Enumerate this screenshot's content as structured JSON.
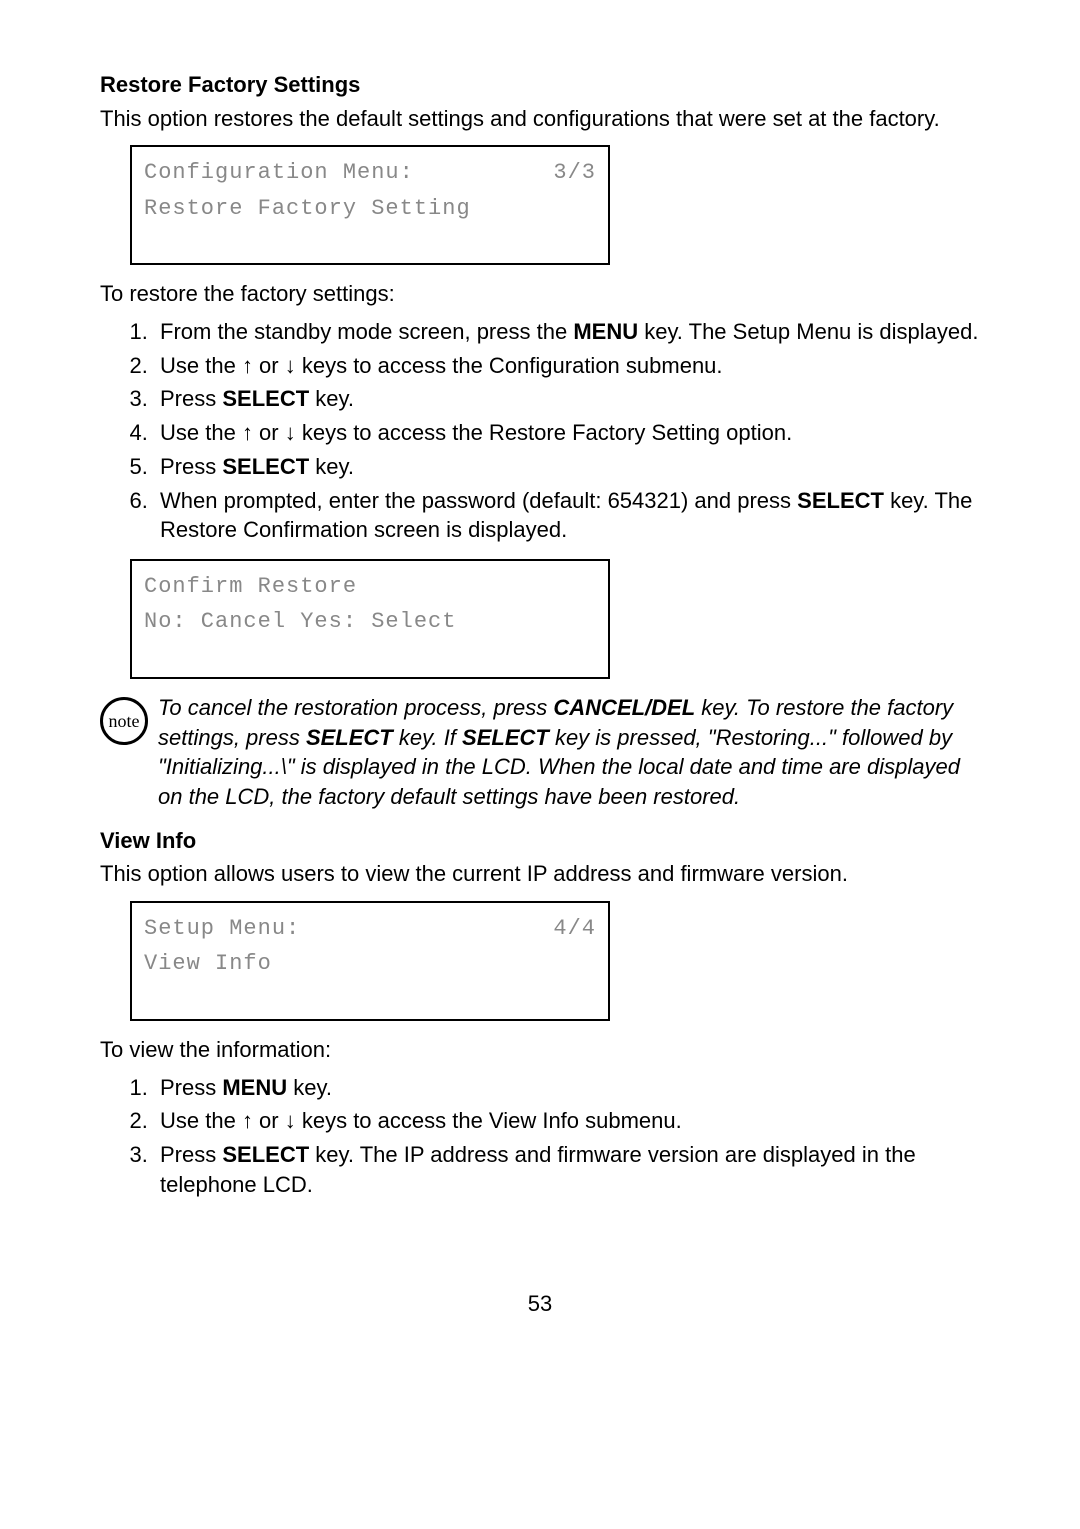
{
  "section1": {
    "title": "Restore Factory Settings",
    "desc": "This option restores the default settings and configurations that were set at the factory.",
    "lcd": {
      "line1_left": "Configuration Menu:",
      "line1_right": "3/3",
      "line2": "Restore Factory Setting"
    },
    "intro": "To restore the factory settings:",
    "steps": {
      "s1a": "From the standby mode screen, press the ",
      "s1b": "MENU",
      "s1c": " key. The Setup Menu is displayed.",
      "s2a": "Use the ",
      "s2b": " or ",
      "s2c": " keys to access the Configuration submenu.",
      "s3a": "Press ",
      "s3b": "SELECT",
      "s3c": " key.",
      "s4a": "Use the ",
      "s4b": " or ",
      "s4c": " keys to access the Restore Factory Setting option.",
      "s5a": "Press ",
      "s5b": "SELECT",
      "s5c": " key.",
      "s6a": "When prompted, enter the password (default: 654321) and press ",
      "s6b": "SELECT",
      "s6c": " key. The Restore Confirmation screen is displayed."
    },
    "lcd2": {
      "line1": "Confirm Restore",
      "line2": "No: Cancel   Yes: Select"
    },
    "note": {
      "label": "note",
      "t1": "To cancel the restoration process, press ",
      "t2": "CANCEL/DEL",
      "t3": " key. To restore the factory settings, press ",
      "t4": "SELECT",
      "t5": " key. If ",
      "t6": "SELECT",
      "t7": " key is pressed, \"Restoring...\" followed by \"Initializing...\\\" is displayed in the LCD. When the local date and time are displayed on the LCD, the factory default settings have been restored."
    }
  },
  "section2": {
    "title": "View Info",
    "desc": "This option allows users to view the current IP address and firmware version.",
    "lcd": {
      "line1_left": "Setup Menu:",
      "line1_right": "4/4",
      "line2": "View Info"
    },
    "intro": "To view the information:",
    "steps": {
      "s1a": "Press ",
      "s1b": "MENU",
      "s1c": " key.",
      "s2a": "Use the ",
      "s2b": " or ",
      "s2c": " keys to access the View Info submenu.",
      "s3a": "Press ",
      "s3b": "SELECT",
      "s3c": " key. The IP address and firmware version are displayed in the telephone LCD."
    }
  },
  "arrows": {
    "up": "↑",
    "down": "↓"
  },
  "page": "53"
}
